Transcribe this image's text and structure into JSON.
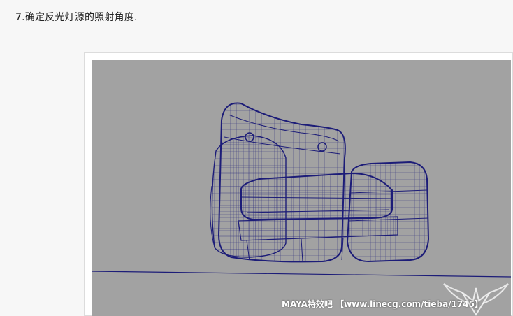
{
  "article": {
    "step_title": "7.确定反光灯源的照射角度."
  },
  "viewport": {
    "background": "#a2a2a2",
    "wire_color": "#1c1c78",
    "watermark": "MAYA特效吧 【www.linecg.com/tieba/1745】",
    "logo_icon": "winged-emblem-icon"
  }
}
